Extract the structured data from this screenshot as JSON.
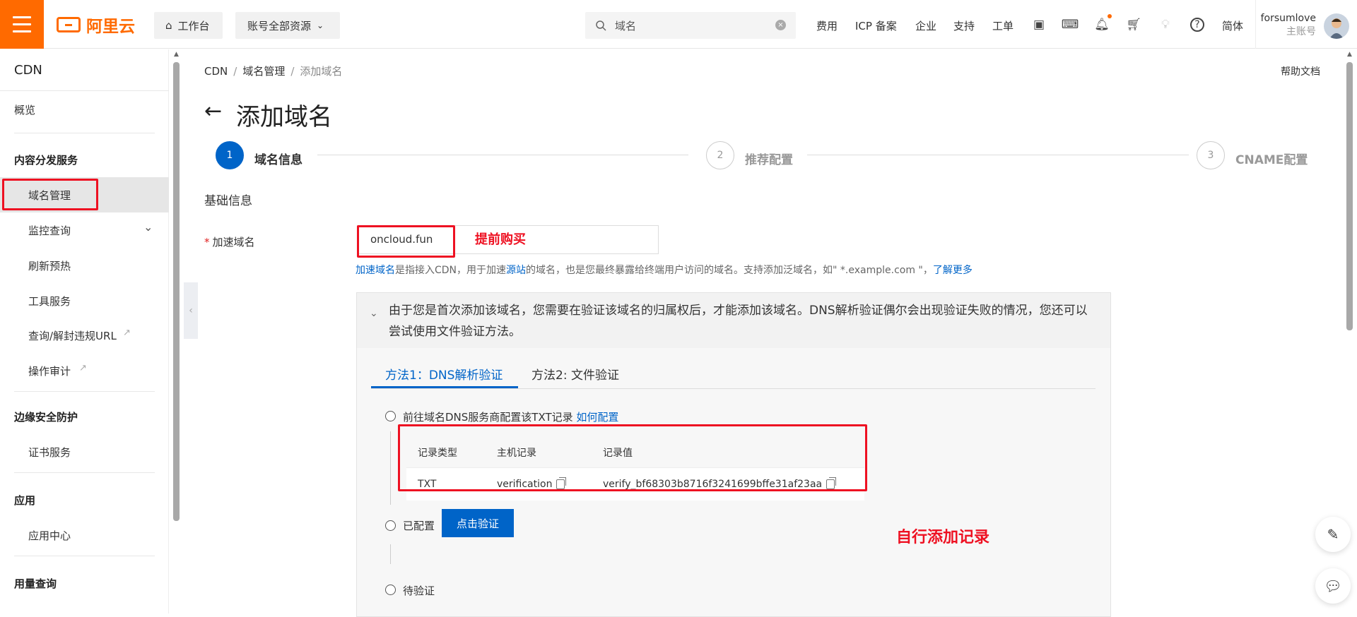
{
  "topbar": {
    "logo_text": "阿里云",
    "workbench_label": "工作台",
    "resource_label": "账号全部资源",
    "search_placeholder": "域名",
    "links": [
      "费用",
      "ICP 备案",
      "企业",
      "支持",
      "工单"
    ],
    "lang": "简体",
    "username": "forsumlove",
    "account_type": "主账号"
  },
  "sidebar": {
    "title": "CDN",
    "overview": "概览",
    "group1": "内容分发服务",
    "items1": [
      "域名管理",
      "监控查询",
      "刷新预热",
      "工具服务",
      "查询/解封违规URL",
      "操作审计"
    ],
    "group2": "边缘安全防护",
    "items2": [
      "证书服务"
    ],
    "group3": "应用",
    "items3": [
      "应用中心"
    ],
    "group4": "用量查询"
  },
  "breadcrumb": [
    "CDN",
    "域名管理",
    "添加域名"
  ],
  "help_doc": "帮助文档",
  "page_title": "添加域名",
  "steps": [
    {
      "num": "1",
      "label": "域名信息"
    },
    {
      "num": "2",
      "label": "推荐配置"
    },
    {
      "num": "3",
      "label": "CNAME配置"
    }
  ],
  "section_title": "基础信息",
  "field": {
    "required_mark": "*",
    "label": "加速域名",
    "value": "oncloud.fun"
  },
  "annotations": {
    "buy_ahead": "提前购买",
    "add_record": "自行添加记录"
  },
  "hint": {
    "link1": "加速域名",
    "text1": "是指接入CDN，用于加速",
    "link2": "源站",
    "text2": "的域名，也是您最终暴露给终端用户访问的域名。支持添加泛域名，如\" *.example.com \"，",
    "link3": "了解更多"
  },
  "verify_panel": {
    "notice_line1": "由于您是首次添加该域名，您需要在验证该域名的归属权后，才能添加该域名。DNS解析验证偶尔会出现验证失败的情况，您还可以",
    "notice_line2": "尝试使用文件验证方法。",
    "tabs": [
      "方法1：DNS解析验证",
      "方法2: 文件验证"
    ],
    "step1_text": "前往域名DNS服务商配置该TXT记录",
    "step1_link": "如何配置",
    "table_headers": [
      "记录类型",
      "主机记录",
      "记录值"
    ],
    "record": {
      "type": "TXT",
      "host": "verification",
      "value": "verify_bf68303b8716f3241699bffe31af23aa"
    },
    "step2_text": "已配置",
    "verify_button": "点击验证",
    "step3_text": "待验证"
  },
  "colors": {
    "brand": "#ff6a00",
    "primary": "#0064c8",
    "annotation_red": "#ee1122"
  }
}
